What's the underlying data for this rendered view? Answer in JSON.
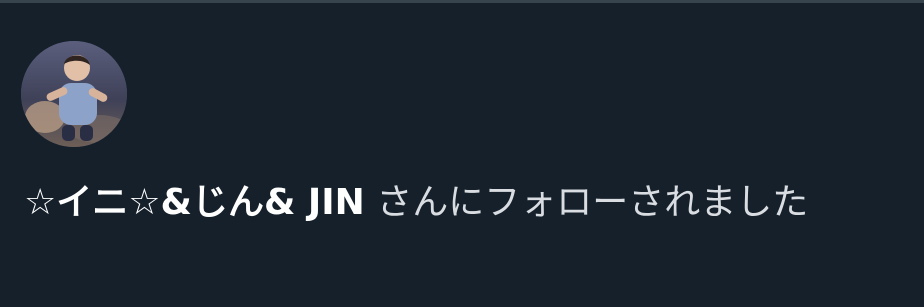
{
  "notification": {
    "user_name": "☆イニ☆&じん& JIN",
    "action_text": " さんにフォローされました",
    "avatar_description": "profile-photo"
  },
  "colors": {
    "background": "#15202b",
    "divider": "#38444d",
    "name_text": "#ffffff",
    "body_text": "#d9dde1"
  }
}
